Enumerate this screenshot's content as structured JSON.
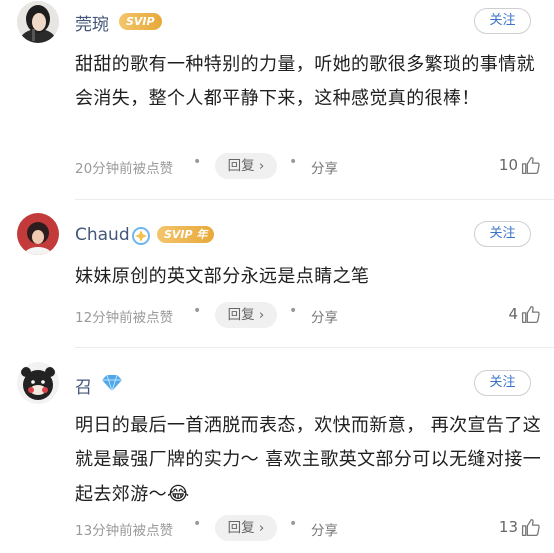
{
  "comments": [
    {
      "username": "莞琬",
      "badge": "SVIP",
      "follow_label": "关注",
      "text": "甜甜的歌有一种特别的力量，听她的歌很多繁琐的事情就会消失，整个人都平静下来，这种感觉真的很棒！",
      "timestamp": "20分钟前被点赞",
      "reply_label": "回复 ›",
      "share_label": "分享",
      "likes": "10"
    },
    {
      "username": "Chaud",
      "badge": "SVIP 年",
      "follow_label": "关注",
      "text": "妹妹原创的英文部分永远是点睛之笔",
      "timestamp": "12分钟前被点赞",
      "reply_label": "回复 ›",
      "share_label": "分享",
      "likes": "4"
    },
    {
      "username": "召",
      "badge": "",
      "follow_label": "关注",
      "text": "明日的最后一首洒脱而表态，欢快而新意， 再次宣告了这就是最强厂牌的实力～ 喜欢主歌英文部分可以无缝对接一起去郊游～",
      "text_emoji": "😂",
      "timestamp": "13分钟前被点赞",
      "reply_label": "回复 ›",
      "share_label": "分享",
      "likes": "13"
    }
  ],
  "icons": {
    "like": "thumbs-up-icon",
    "diamond": "diamond-icon",
    "separator": "dot-separator"
  },
  "colors": {
    "username": "#44577a",
    "follow": "#3a74c9",
    "vip_gold": "#e7a93a",
    "diamond": "#4fa8ea"
  }
}
